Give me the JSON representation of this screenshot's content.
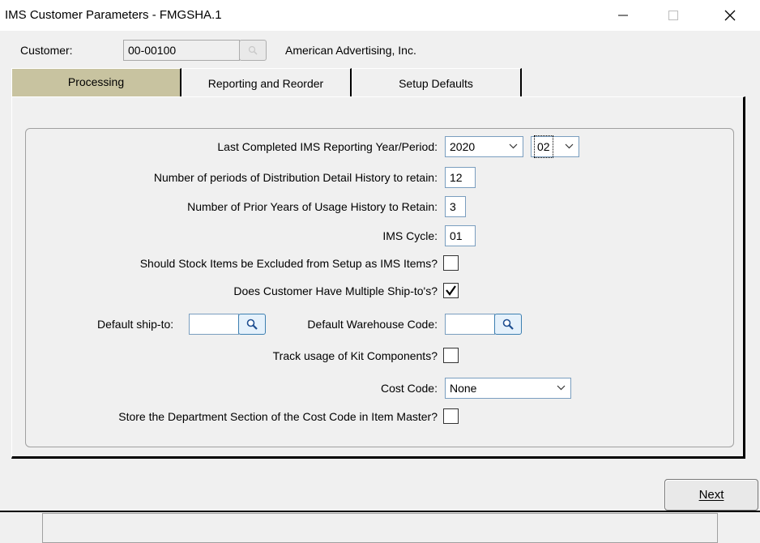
{
  "window": {
    "title": "IMS Customer Parameters - FMGSHA.1"
  },
  "customer": {
    "label": "Customer:",
    "code": "00-00100",
    "name": "American Advertising, Inc."
  },
  "tabs": [
    {
      "label": "Processing",
      "active": true
    },
    {
      "label": "Reporting and Reorder",
      "active": false
    },
    {
      "label": "Setup Defaults",
      "active": false
    }
  ],
  "form": {
    "reporting_period": {
      "label": "Last Completed IMS Reporting Year/Period:",
      "year": "2020",
      "period": "02"
    },
    "dist_history": {
      "label": "Number of periods of Distribution Detail History to retain:",
      "value": "12"
    },
    "usage_history": {
      "label": "Number of Prior Years of Usage History to Retain:",
      "value": "3"
    },
    "ims_cycle": {
      "label": "IMS Cycle:",
      "value": "01"
    },
    "exclude_stock": {
      "label": "Should Stock Items be Excluded from Setup as IMS Items?",
      "checked": false
    },
    "multiple_shiptos": {
      "label": "Does Customer Have Multiple Ship-to's?",
      "checked": true
    },
    "default_shipto": {
      "label": "Default ship-to:",
      "value": ""
    },
    "default_warehouse": {
      "label": "Default Warehouse Code:",
      "value": ""
    },
    "track_kit": {
      "label": "Track usage of Kit Components?",
      "checked": false
    },
    "cost_code": {
      "label": "Cost Code:",
      "value": "None"
    },
    "store_department": {
      "label": "Store the Department Section of the Cost Code in Item Master?",
      "checked": false
    }
  },
  "buttons": {
    "next": "Next"
  },
  "colors": {
    "active_tab": "#c8c3a0",
    "field_border": "#7a9ebf",
    "lookup_active": "#e5f1fb"
  }
}
